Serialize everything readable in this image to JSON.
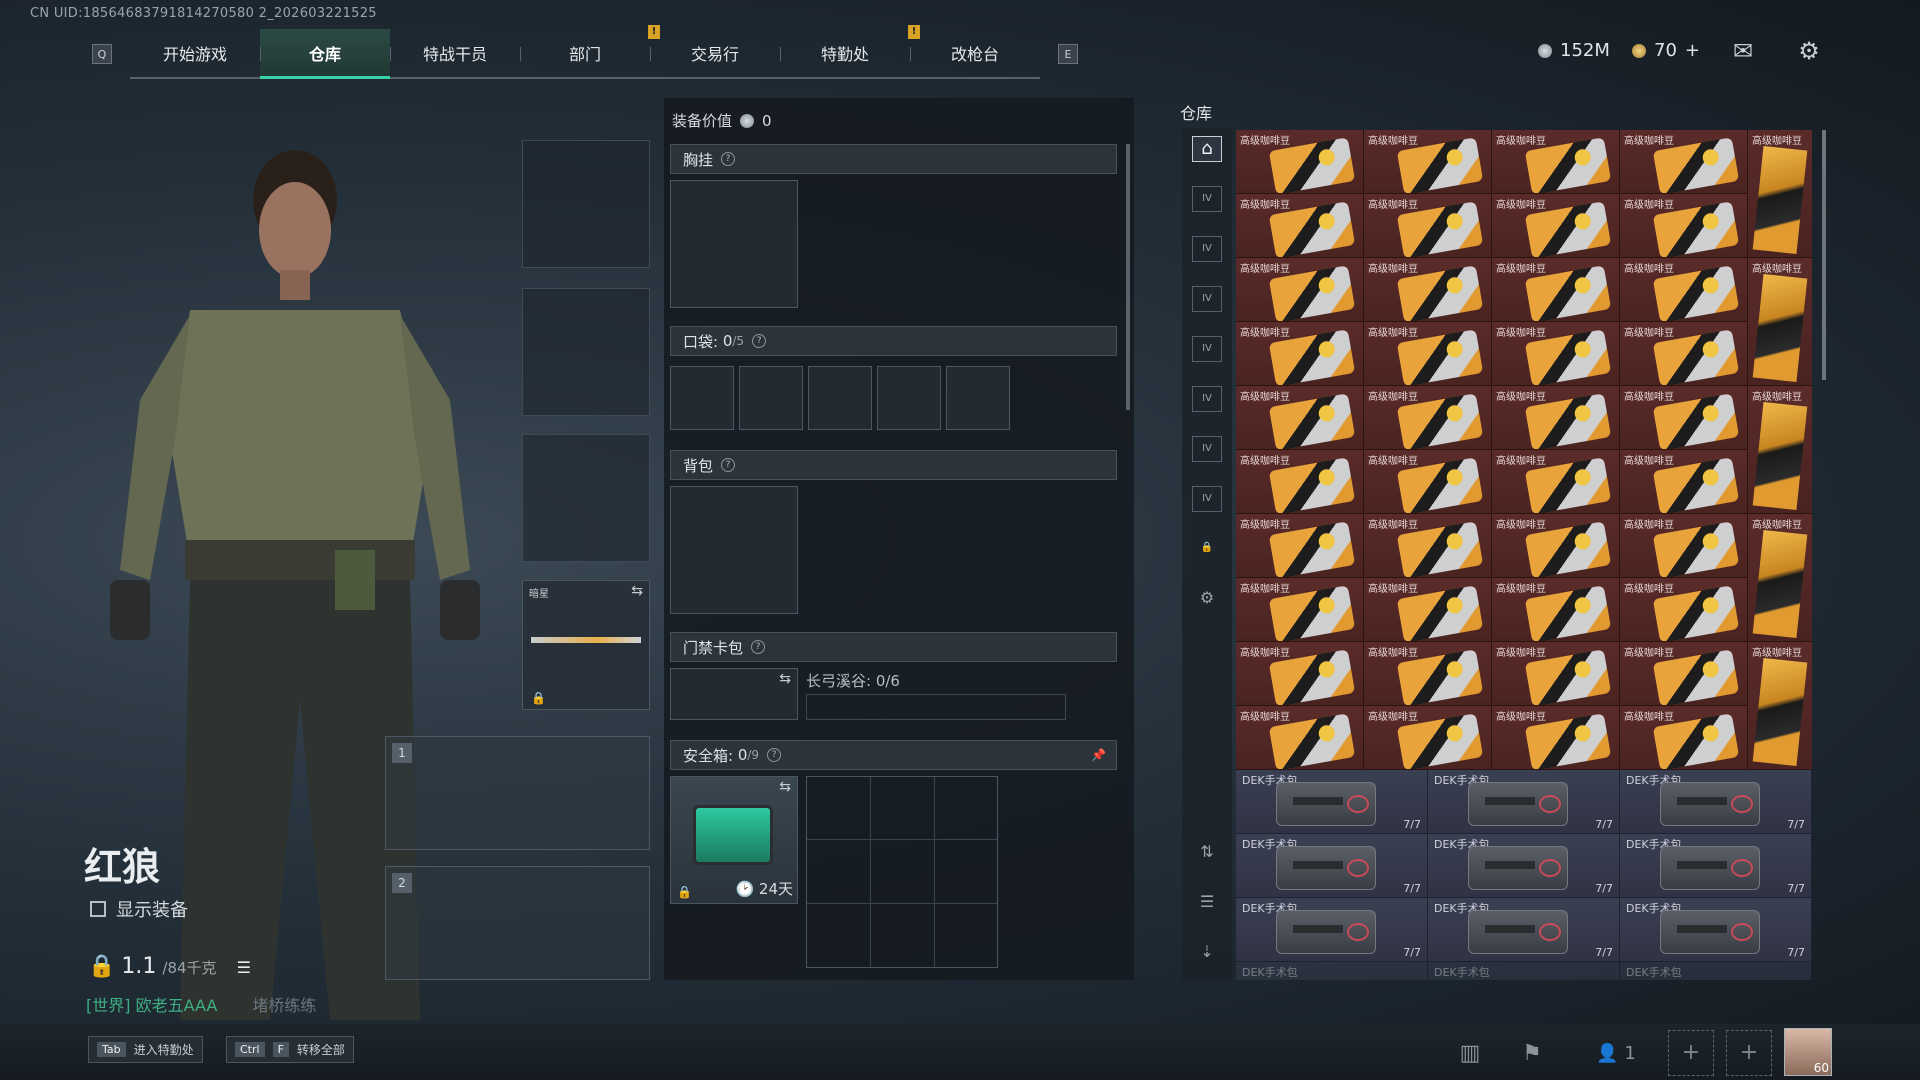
{
  "uid": "CN UID:18564683791814270580 2_202603221525",
  "nav": {
    "left_key": "Q",
    "right_key": "E",
    "tabs": [
      {
        "label": "开始游戏"
      },
      {
        "label": "仓库"
      },
      {
        "label": "特战干员"
      },
      {
        "label": "部门"
      },
      {
        "label": "交易行"
      },
      {
        "label": "特勤处"
      },
      {
        "label": "改枪台"
      }
    ],
    "active_tab": "仓库",
    "notif_mark": "!"
  },
  "currency": {
    "coins": "152M",
    "gold": "70",
    "gold_add": "+"
  },
  "operator": {
    "name": "红狼",
    "show_gear_label": "显示装备",
    "weight_value": "1.1",
    "weight_max": "/84千克",
    "world_chat": "[世界] 欧老五AAA",
    "world_chat_extra": "堵桥练练"
  },
  "equipment": {
    "melee_label": "暗星",
    "gun_slots": [
      "1",
      "2"
    ]
  },
  "loadout": {
    "value_label": "装备价值",
    "value": "0",
    "chest_rig": "胸挂",
    "pockets_label": "口袋:",
    "pockets_count": "0",
    "pockets_max": "/5",
    "backpack": "背包",
    "keycard": "门禁卡包",
    "keycard_map": "长弓溪谷: 0/6",
    "safebox_label": "安全箱:",
    "safebox_count": "0",
    "safebox_max": "/9",
    "safebox_days": "24天"
  },
  "storage": {
    "title": "仓库",
    "coffee_name": "高级咖啡豆",
    "medkit_name": "DEK手术包",
    "medkit_count": "7/7",
    "medkit_ghost": "DEK手术包"
  },
  "bottom": {
    "tab_key": "Tab",
    "tab_label": "进入特勤处",
    "ctrl_key": "Ctrl",
    "f_key": "F",
    "transfer_label": "转移全部",
    "friends_count": "1",
    "level": "60"
  }
}
